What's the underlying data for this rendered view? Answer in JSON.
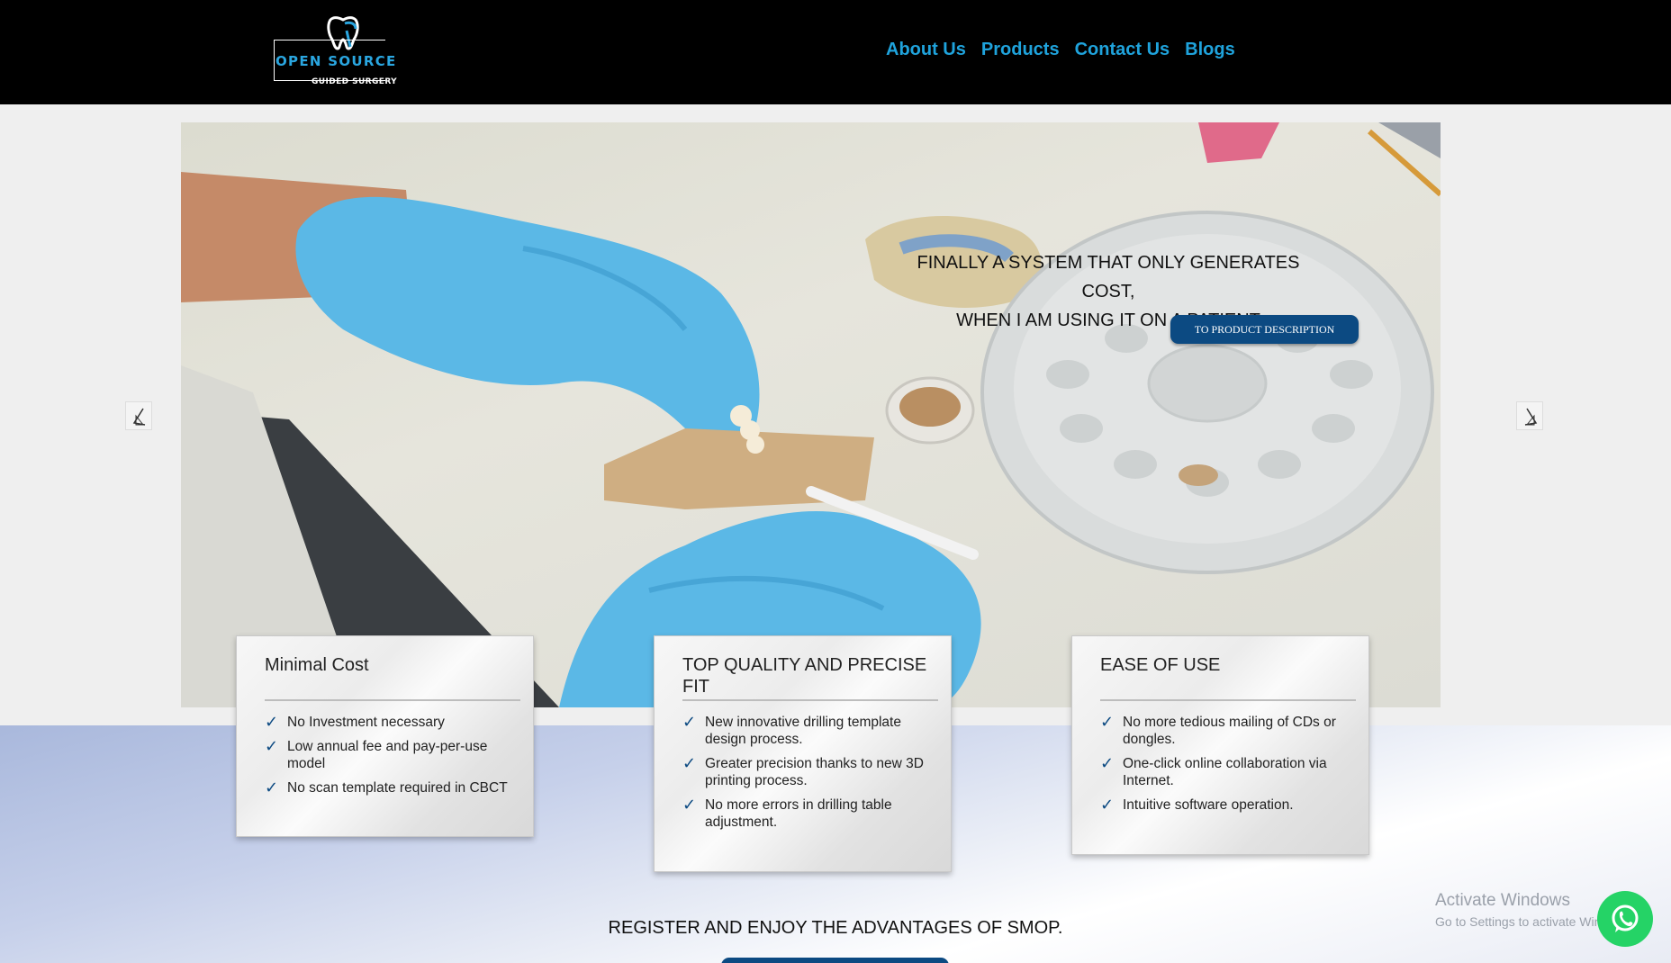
{
  "header": {
    "logo_main": "OPEN SOURCE",
    "logo_sub": "GUIDED SURGERY",
    "nav": [
      {
        "label": "About Us"
      },
      {
        "label": "Products"
      },
      {
        "label": "Contact Us"
      },
      {
        "label": "Blogs"
      }
    ]
  },
  "hero": {
    "caption_line1": "FINALLY A SYSTEM THAT ONLY GENERATES COST,",
    "caption_line2": "WHEN I AM USING IT ON A PATIENT",
    "button_label": "TO PRODUCT DESCRIPTION",
    "prev_icon": "chevron-left-icon",
    "next_icon": "chevron-right-icon"
  },
  "features": [
    {
      "title": "Minimal Cost",
      "items": [
        "No Investment necessary",
        "Low annual fee and pay-per-use model",
        "No scan template required in CBCT"
      ]
    },
    {
      "title": "TOP QUALITY AND PRECISE FIT",
      "items": [
        "New innovative drilling template design process.",
        "Greater precision thanks to new 3D printing process.",
        "No more errors in drilling table adjustment."
      ]
    },
    {
      "title": "EASE OF USE",
      "items": [
        "No more tedious mailing of CDs or dongles.",
        "One-click online collaboration via Internet.",
        "Intuitive software operation."
      ]
    }
  ],
  "check_glyph": "✓",
  "register": {
    "text": "REGISTER AND ENJOY THE ADVANTAGES OF SMOP."
  },
  "watermark": {
    "line1": "Activate Windows",
    "line2": "Go to Settings to activate Windows."
  },
  "colors": {
    "nav": "#1fa3dc",
    "button": "#0c4a82",
    "whatsapp": "#25d366",
    "header_bg": "#000000"
  }
}
